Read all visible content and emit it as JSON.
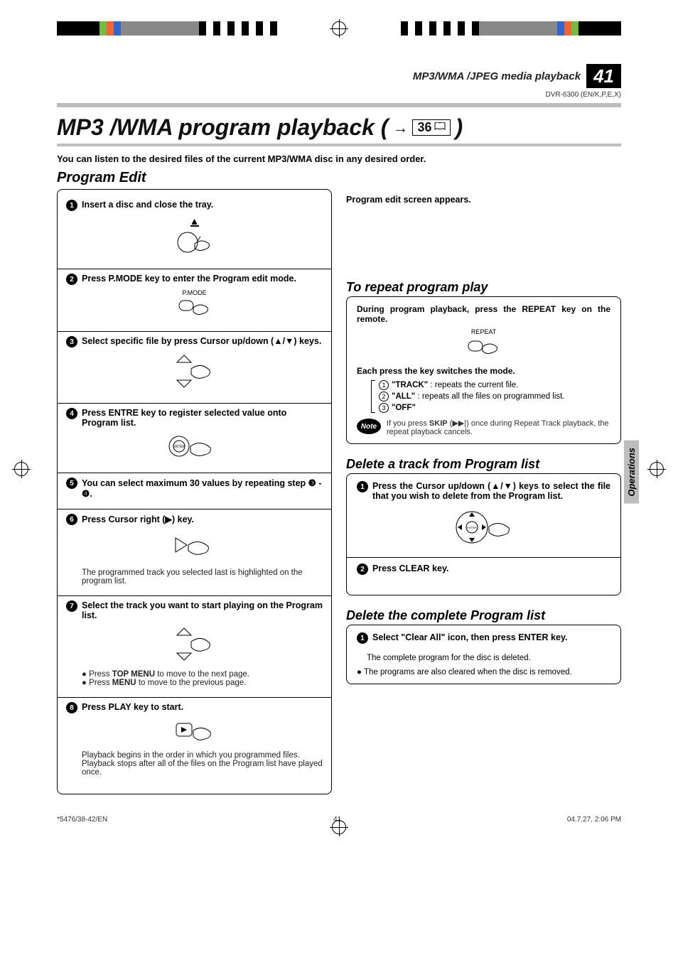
{
  "header": {
    "category": "MP3/WMA /JPEG media playback",
    "page_number": "41",
    "model": "DVR-6300 (EN/K,P,E,X)"
  },
  "title": {
    "main": "MP3 /WMA program playback (",
    "xref_arrow": "→",
    "xref_page": "36",
    "close": ")"
  },
  "intro": "You can listen to the desired files of the current MP3/WMA disc in any desired order.",
  "program_edit_heading": "Program Edit",
  "steps": {
    "s1": "Insert a disc and close the tray.",
    "s1_icon": "eject-icon",
    "s2": "Press P.MODE key  to enter the Program edit mode.",
    "s2_icon_label": "P.MODE",
    "s3": "Select specific file by press Cursor up/down (▲/▼) keys.",
    "s4": "Press ENTRE key  to register selected value onto Program list.",
    "s4_icon_label": "ENTER",
    "s5": "You can select maximum 30 values by repeating step ❸ - ❹.",
    "s6": "Press Cursor right (▶) key.",
    "s6_note": "The programmed track you selected last is highlighted on the program list.",
    "s7": "Select the track you want to start playing on the Program list.",
    "s7_b1_pre": "Press ",
    "s7_b1_bold": "TOP MENU",
    "s7_b1_post": "  to move to the next page.",
    "s7_b2_pre": "Press ",
    "s7_b2_bold": "MENU",
    "s7_b2_post": " to move to the previous page.",
    "s8": "Press PLAY key to start.",
    "s8_note": "Playback begins in the order in which you programmed files. Playback stops after all of the files on the Program list have played once."
  },
  "right": {
    "appear": "Program edit screen appears.",
    "repeat_heading": "To repeat program play",
    "repeat_instruction": "During program playback, press the REPEAT key on the remote.",
    "repeat_icon_label": "REPEAT",
    "switch_line": "Each press the key switches the mode.",
    "m1_label": "\"TRACK\"",
    "m1_desc": " : repeats the current file.",
    "m2_label": "\"ALL\"",
    "m2_desc": "  : repeats all the files on programmed list.",
    "m3_label": "\"OFF\"",
    "note_label": "Note",
    "note_text_pre": "If you press ",
    "note_text_bold": "SKIP",
    "note_text_sym": " (▶▶|) ",
    "note_text_post": "once during Repeat Track playback, the repeat playback cancels.",
    "delete_track_heading": "Delete a track from Program list",
    "dt1": "Press the Cursor up/down (▲/▼) keys to select the file that you wish to delete from the Program list.",
    "dt2": "Press CLEAR key.",
    "delete_all_heading": "Delete the complete Program list",
    "da1": "Select \"Clear All\" icon, then press ENTER key.",
    "da_note": "The complete program for the disc is deleted.",
    "da_b1": "The programs are also cleared when the disc is removed."
  },
  "side_tab": "Operations",
  "footer": {
    "left": "*5476/38-42/EN",
    "mid": "41",
    "right": "04.7.27, 2:06 PM"
  }
}
